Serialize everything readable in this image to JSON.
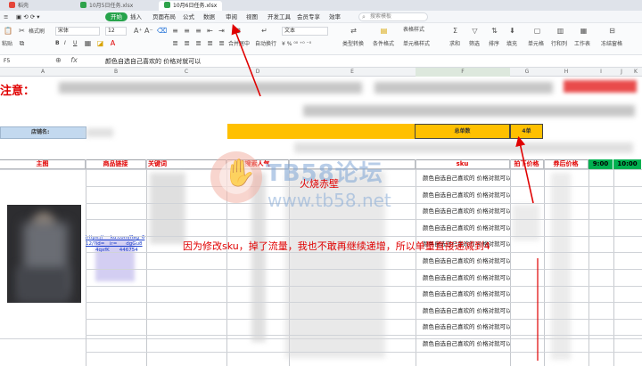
{
  "tabs": [
    {
      "label": "稻壳",
      "active": false
    },
    {
      "label": "10月5日任务.xlsx",
      "active": false
    },
    {
      "label": "10月6日任务.xlsx",
      "active": true
    }
  ],
  "menu": {
    "items": [
      "开始",
      "插入",
      "页面布局",
      "公式",
      "数据",
      "审阅",
      "视图",
      "开发工具",
      "会员专享",
      "效率"
    ],
    "search_placeholder": "搜索模板"
  },
  "toolbar": {
    "paste_label": "粘贴",
    "format_painter": "格式刷",
    "font_name": "宋体",
    "font_size": "12",
    "merge_label": "合并居中",
    "wrap_label": "自动换行",
    "number_format": "文本",
    "type_convert": "类型转换",
    "cond_format": "条件格式",
    "table_style": "表格样式",
    "cell_style": "单元格样式",
    "sum_label": "求和",
    "filter_label": "筛选",
    "sort_label": "排序",
    "fill_label": "填充",
    "cell_label": "单元格",
    "rowcol_label": "行和列",
    "sheet_label": "工作表",
    "freeze_label": "冻结窗格"
  },
  "formula_bar": {
    "cell_ref": "F5",
    "content": "颜色自选自己喜欢的 价格对就可以"
  },
  "columns": [
    "A",
    "B",
    "C",
    "D",
    "E",
    "F",
    "G",
    "H",
    "I",
    "J",
    "K"
  ],
  "sheet": {
    "notice_label": "注意：",
    "shop_label": "店铺名:",
    "order_count_label": "总单数",
    "order_count_value": "4单",
    "headers": {
      "main_image": "主图",
      "product_link": "商品链接",
      "keyword": "关键词",
      "search_popularity": "搜索人气",
      "sku": "sku",
      "price": "拍下价格",
      "coupon_price": "券后价格",
      "time1": "9:00",
      "time2": "10:00"
    },
    "sku_rows": [
      "颜色自选自己喜欢的 价格对就可以",
      "颜色自选自己喜欢的 价格对就可以",
      "颜色自选自己喜欢的 价格对就可以",
      "颜色自选自己喜欢的 价格对就可以",
      "颜色自选自己喜欢的 价格对就可以",
      "颜色自选自己喜欢的 价格对就可以",
      "颜色自选自己喜欢的 价格对就可以",
      "颜色自选自己喜欢的 价格对就可以",
      "颜色自选自己喜欢的 价格对就可以",
      "颜色自选自己喜欢的 价格对就可以",
      "颜色自选自己喜欢的 价格对就可以"
    ],
    "link_text": "https://___ku.com/flag_612/?id=__ir= ___dgGu8 ____4qxfK____446754"
  },
  "watermark": {
    "brand": "TB58论坛",
    "url": "www.tb58.net"
  },
  "annotations": {
    "fire": "火烧赤壁",
    "main": "因为修改sku，掉了流量，我也不敢再继续递增，所以单量直接递减到4"
  },
  "colors": {
    "accent_green": "#27a34b",
    "notice_red": "#e00000",
    "header_yellow": "#ffc000",
    "time_green": "#00b050",
    "shop_blue": "#c3d9ef"
  }
}
